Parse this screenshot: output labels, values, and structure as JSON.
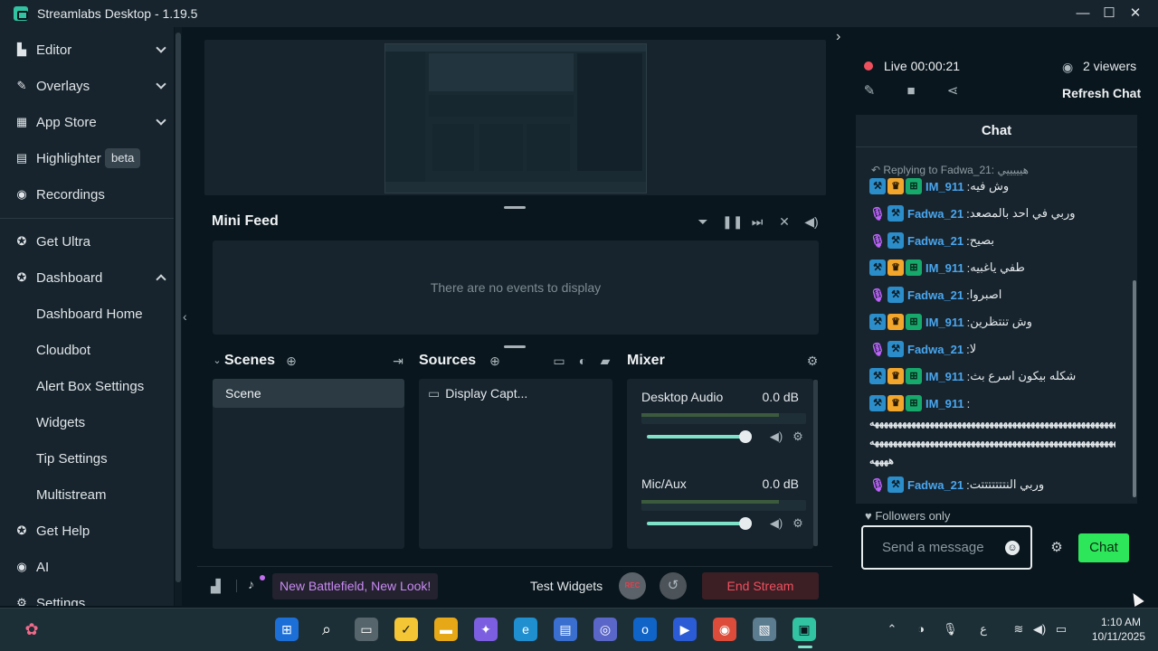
{
  "window": {
    "title": "Streamlabs Desktop - 1.19.5"
  },
  "sidebar": {
    "items": [
      {
        "label": "Editor"
      },
      {
        "label": "Overlays"
      },
      {
        "label": "App Store"
      },
      {
        "label": "Highlighter",
        "badge": "beta"
      },
      {
        "label": "Recordings"
      },
      {
        "label": "Get Ultra"
      },
      {
        "label": "Dashboard"
      },
      {
        "label": "Dashboard Home"
      },
      {
        "label": "Cloudbot"
      },
      {
        "label": "Alert Box Settings"
      },
      {
        "label": "Widgets"
      },
      {
        "label": "Tip Settings"
      },
      {
        "label": "Multistream"
      },
      {
        "label": "Get Help"
      },
      {
        "label": "AI"
      },
      {
        "label": "Settings"
      }
    ]
  },
  "minifeed": {
    "title": "Mini Feed",
    "empty_text": "There are no events to display"
  },
  "scenes": {
    "title": "Scenes",
    "items": [
      "Scene"
    ]
  },
  "sources": {
    "title": "Sources",
    "items": [
      "Display Capt..."
    ]
  },
  "mixer": {
    "title": "Mixer",
    "channels": [
      {
        "name": "Desktop Audio",
        "db": "0.0 dB",
        "volume": 1.0
      },
      {
        "name": "Mic/Aux",
        "db": "0.0 dB",
        "volume": 1.0
      }
    ]
  },
  "footer": {
    "news": "New Battlefield, New Look!",
    "test_widgets": "Test Widgets",
    "rec": "REC",
    "end_stream": "End Stream"
  },
  "stream": {
    "status": "Live",
    "time": "00:00:21",
    "viewers": "2 viewers",
    "refresh": "Refresh Chat"
  },
  "chat": {
    "title": "Chat",
    "replying": "Replying to Fadwa_21: هيييييي",
    "messages": [
      {
        "user": "IM_911",
        "text": "وش فيه"
      },
      {
        "user": "Fadwa_21",
        "text": "وربي في احد بالمصعد"
      },
      {
        "user": "Fadwa_21",
        "text": "بصيح"
      },
      {
        "user": "IM_911",
        "text": "طفي ياغبيه"
      },
      {
        "user": "Fadwa_21",
        "text": "اصبروا"
      },
      {
        "user": "IM_911",
        "text": "وش تنتظرين"
      },
      {
        "user": "Fadwa_21",
        "text": "لا"
      },
      {
        "user": "IM_911",
        "text": "شكله بيكون اسرع بث"
      },
      {
        "user": "IM_911",
        "text": ""
      },
      {
        "user": "Fadwa_21",
        "text": "وربي النتتتتتتتت"
      }
    ],
    "long_line_1": "ههههههههههههههههههههههههههههههههههههههههههههههههههههههههههههههههههه",
    "long_line_2": "هههههههههههههههههههههههههههههههههههههههههههههههههههههههههههههههههههه",
    "long_line_3": "ههههه",
    "followers_only": "Followers only",
    "input_placeholder": "Send a message",
    "send_label": "Chat"
  },
  "taskbar": {
    "time": "1:10 AM",
    "date": "10/11/2025",
    "lang": "ع"
  },
  "colors": {
    "accent": "#31c3a2",
    "live": "#f0505e",
    "chat_button": "#2ee65a",
    "badge_purple": "#c063ff"
  }
}
